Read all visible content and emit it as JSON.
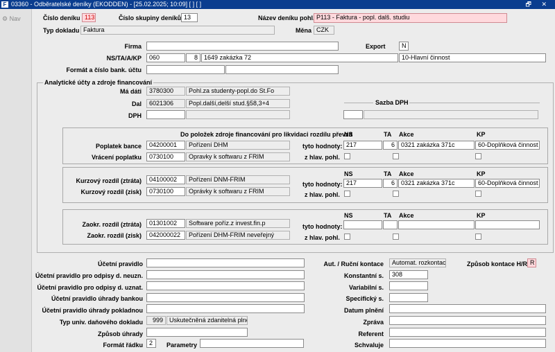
{
  "window": {
    "title": "03360 - Odběratelské deníky (EKODDEN) - [25.02.2025; 10:09]  [ ]  [ ]",
    "logo": "F",
    "buttons": "🗗 ✕"
  },
  "left_nav": {
    "label": "Nav"
  },
  "header": {
    "cislo_deniku_label": "Číslo deníku",
    "cislo_deniku": "113",
    "cislo_skupiny_label": "Číslo skupiny deníků",
    "cislo_skupiny": "13",
    "nazev_label": "Název deníku pohl.",
    "nazev": "P113 - Faktura - popl. dalš. studiu",
    "typ_dokladu_label": "Typ dokladu",
    "typ_dokladu": "Faktura",
    "mena_label": "Měna",
    "mena": "CZK"
  },
  "firma": {
    "firma_label": "Firma",
    "firma": "",
    "export_label": "Export",
    "export": "N",
    "ns_label": "NS/TA/A/KP",
    "ns": "060",
    "ta": "8",
    "akce": "1649 zakázka 72",
    "kp": "10-Hlavní činnost",
    "format_ucet_label": "Formát a číslo bank. účtu",
    "format": "",
    "ucet": ""
  },
  "analytic": {
    "legend": "Analytické účty a zdroje financování",
    "ma_dati_label": "Má dáti",
    "ma_dati_code": "3780300",
    "ma_dati_name": "Pohl.za studenty-popl.do St.Fo",
    "dal_label": "Dal",
    "dal_code": "6021306",
    "dal_name": "Popl.další,delší stud.§58,3+4",
    "dph_label": "DPH",
    "dph_code": "",
    "dph_name": "",
    "sazba_label": "Sazba DPH",
    "sazba_code": "",
    "sazba_name": ""
  },
  "zdroje": {
    "heading": "Do položek zdroje financování pro likvidaci rozdílu převzít",
    "col_ns": "NS",
    "col_ta": "TA",
    "col_akce": "Akce",
    "col_kp": "KP",
    "hodnoty_label": "tyto hodnoty:",
    "hlav_label": "z hlav. pohl.",
    "g1": {
      "row1_label": "Poplatek bance",
      "row1_code": "04200001",
      "row1_name": "Pořízení DHM",
      "row2_label": "Vrácení poplatku",
      "row2_code": "0730100",
      "row2_name": "Opravky k softwaru z FRIM",
      "ns": "217",
      "ta": "6",
      "akce": "0321 zakázka 371c",
      "kp": "60-Doplňková činnost"
    },
    "g2": {
      "row1_label": "Kurzový rozdíl (ztráta)",
      "row1_code": "04100002",
      "row1_name": "Pořízení DNM-FRIM",
      "row2_label": "Kurzový rozdíl (zisk)",
      "row2_code": "0730100",
      "row2_name": "Oprávky k softwaru z FRIM",
      "ns": "217",
      "ta": "6",
      "akce": "0321 zakázka 371c",
      "kp": "60-Doplňková činnost"
    },
    "g3": {
      "row1_label": "Zaokr. rozdíl (ztráta)",
      "row1_code": "01301002",
      "row1_name": "Software poříz.z invest.fin.p",
      "row2_label": "Zaokr. rozdíl (zisk)",
      "row2_code": "042000022",
      "row2_name": "Pořízení DHM-FRIM neveřejný",
      "ns": "",
      "ta": "",
      "akce": "",
      "kp": ""
    }
  },
  "bottom_left": {
    "ucetni_pravidlo_label": "Účetní pravidlo",
    "ucetni_pravidlo": "",
    "neuzn_label": "Účetní pravidlo pro odpisy d. neuzn.",
    "neuzn": "",
    "uznat_label": "Účetní pravidlo pro odpisy d. uznat.",
    "uznat": "",
    "bankou_label": "Účetní pravidlo úhrady bankou",
    "bankou": "",
    "pokladnou_label": "Účetní pravidlo úhrady pokladnou",
    "pokladnou": "",
    "typ_univ_label": "Typ univ. daňového dokladu",
    "typ_univ_code": "999",
    "typ_univ_name": "Uskutečněná zdanitelná plnění",
    "zpusob_uhrady_label": "Způsob úhrady",
    "zpusob_uhrady": "",
    "format_radku_label": "Formát řádku",
    "format_radku": "2",
    "parametry_label": "Parametry",
    "parametry": ""
  },
  "bottom_right": {
    "aut_label": "Aut. / Ruční kontace",
    "aut": "Automat. rozkontace",
    "zpusob_kontace_label": "Způsob kontace H/R",
    "zpusob_kontace": "R",
    "konstantni_label": "Konstantní s.",
    "konstantni": "308",
    "variabilni_label": "Variabilní s.",
    "variabilni": "",
    "specificky_label": "Specifický s.",
    "specificky": "",
    "datum_label": "Datum plnění",
    "datum": "",
    "zprava_label": "Zpráva",
    "zprava": "",
    "referent_label": "Referent",
    "referent": "",
    "schvaluje_label": "Schvaluje",
    "schvaluje": ""
  }
}
